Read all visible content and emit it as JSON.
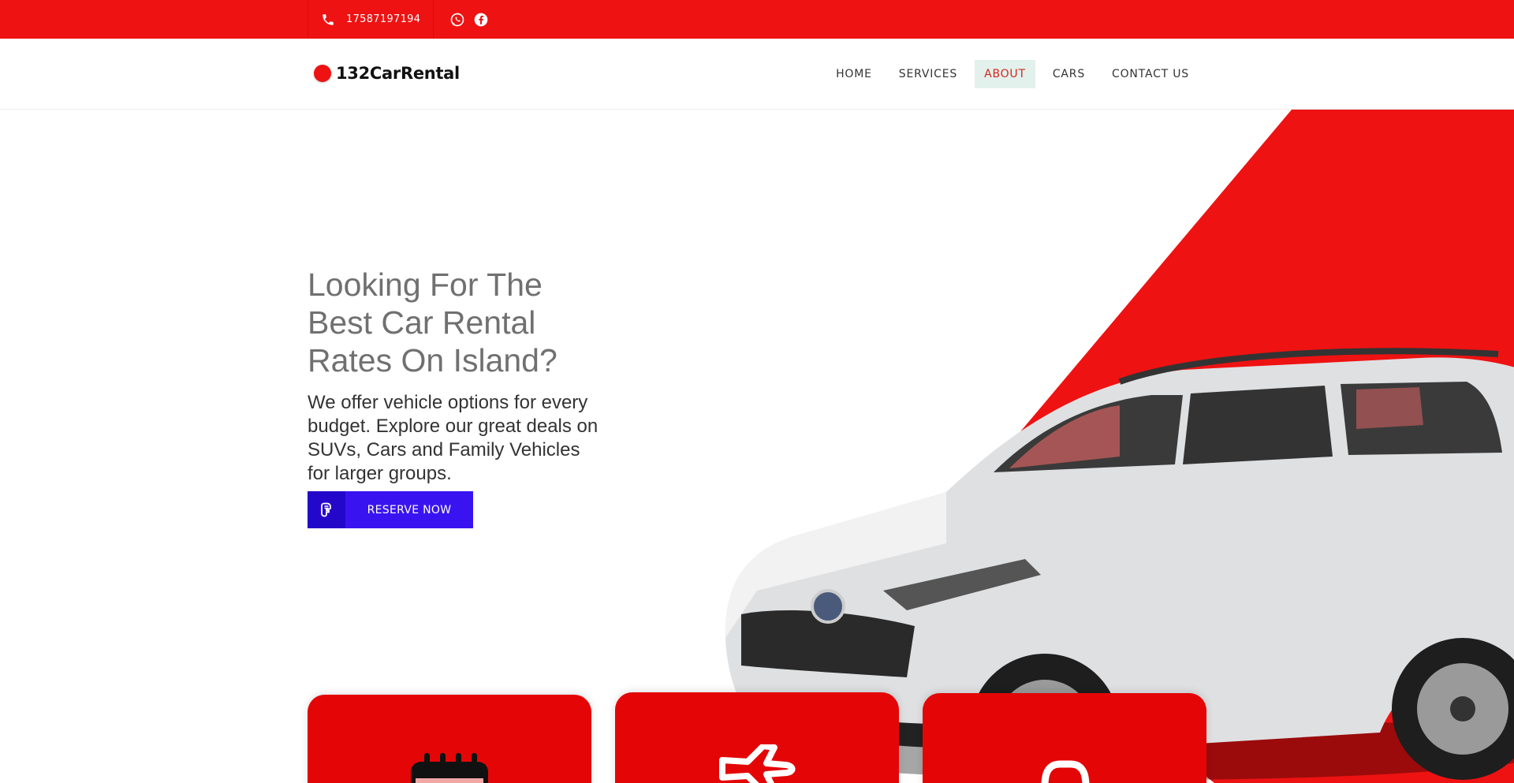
{
  "topbar": {
    "phone": "17587197194",
    "phone_icon": "phone-icon",
    "socials": [
      {
        "name": "whatsapp-icon"
      },
      {
        "name": "facebook-icon"
      }
    ]
  },
  "header": {
    "logo_text": "132CarRental",
    "nav": [
      {
        "label": "HOME",
        "active": false
      },
      {
        "label": "SERVICES",
        "active": false
      },
      {
        "label": "ABOUT",
        "active": true
      },
      {
        "label": "CARS",
        "active": false
      },
      {
        "label": "CONTACT US",
        "active": false
      }
    ]
  },
  "hero": {
    "title": "Looking For The Best Car Rental Rates On Island?",
    "description": "We offer vehicle options for every budget. Explore our great deals on SUVs, Cars and Family Vehicles for larger groups.",
    "cta_label": "RESERVE NOW",
    "cta_icon": "hand-icon"
  },
  "cards": [
    {
      "icon": "calendar-icon"
    },
    {
      "icon": "airplane-icon"
    },
    {
      "icon": "car-icon"
    }
  ],
  "colors": {
    "brand_red": "#ee1212",
    "card_red": "#e40606",
    "cta_blue": "#3a14f0",
    "nav_active_text": "#d4261e",
    "nav_active_bg": "#e3f1ec"
  }
}
